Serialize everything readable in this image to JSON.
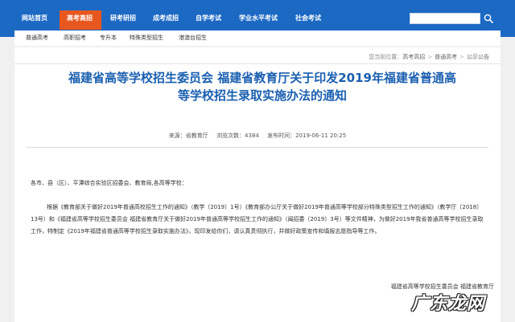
{
  "nav": {
    "items": [
      {
        "label": "网站首页"
      },
      {
        "label": "高考高招"
      },
      {
        "label": "研考研招"
      },
      {
        "label": "成考成招"
      },
      {
        "label": "自学考试"
      },
      {
        "label": "学业水平考试"
      },
      {
        "label": "社会考试"
      }
    ],
    "active_index": 1,
    "colors": {
      "bar": "#1c69c4",
      "active": "#e8571e"
    }
  },
  "subnav": {
    "items": [
      {
        "label": "普通高考"
      },
      {
        "label": "高职招考"
      },
      {
        "label": "专升本"
      },
      {
        "label": "特殊类型招生"
      },
      {
        "label": "港澳台招生"
      }
    ]
  },
  "breadcrumb": {
    "prefix": "您当前位置：",
    "items": [
      "高考高招",
      "普通高考",
      "公示公告"
    ]
  },
  "article": {
    "title_line1": "福建省高等学校招生委员会 福建省教育厅关于印发2019年福建省普通高",
    "title_line2": "等学校招生录取实施办法的通知",
    "source": "来源：省教育厅",
    "views": "浏览次数：4384",
    "published": "发布时间：2019-06-11 20:25",
    "greeting": "各市、县（区）、平潭综合实验区招委会、教育局,各高等学校：",
    "body": "根据《教育部关于做好2019年普通高校招生工作的通知》（教学〔2019〕1号）《教育部办公厅关于做好2019年普通高等学校部分特殊类型招生工作的通知》（教学厅〔2018〕13号）和《福建省高等学校招生委员会 福建省教育厅关于做好2019年普通高等学校招生工作的通知》（闽招委〔2019〕3号）等文件精神，为做好2019年我省普通高等学校招生录取工作，特制定《2019年福建省普通高等学校招生录取实施办法》，现印发给你们，请认真贯彻执行，并做好政策宣传和填报志愿指导等工作。",
    "signature": "福建省高等学校招生委员会 福建省教育厅"
  },
  "watermark": {
    "text": "广东龙网"
  }
}
